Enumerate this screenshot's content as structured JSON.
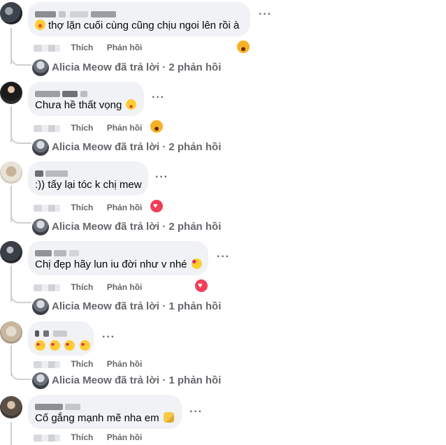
{
  "actions": {
    "like": "Thích",
    "reply": "Phản hồi"
  },
  "colors": {
    "secondary_text": "#65676b",
    "bubble_bg": "#f0f2f5",
    "thread_line": "#ced0d4",
    "love_reaction": "#f33e58",
    "haha_reaction": "#f7b125"
  },
  "comments": [
    {
      "text": "thợ lặn cuối cùng cũng chịu ngoi lên rồi à",
      "leading_emoji": "rofl-emoji",
      "reaction_icon": "haha-reaction-icon",
      "replies_summary": "Alicia Meow đã trả lời · 2 phản hồi"
    },
    {
      "text": "Chưa hề thất vọng",
      "trailing_emoji": "flushed-emoji",
      "reaction_icon": "haha-reaction-icon",
      "replies_summary": "Alicia Meow đã trả lời · 2 phản hồi"
    },
    {
      "text": ":)) tấy lại tóc k chị mew",
      "reaction_icon": "love-reaction-icon",
      "replies_summary": "Alicia Meow đã trả lời · 2 phản hồi"
    },
    {
      "text": "Chị đẹp hãy lun iu đời như v nhé",
      "trailing_emoji": "smiling-hearts-emoji",
      "reaction_icon": "love-reaction-icon",
      "replies_summary": "Alicia Meow đã trả lời · 1 phản hồi"
    },
    {
      "text": "",
      "emoji_row": "heart-eyes-emoji x4",
      "replies_summary": "Alicia Meow đã trả lời · 1 phản hồi"
    },
    {
      "text": "Cố gắng mạnh mẽ nha em",
      "trailing_emoji": "flexed-biceps-emoji"
    }
  ]
}
